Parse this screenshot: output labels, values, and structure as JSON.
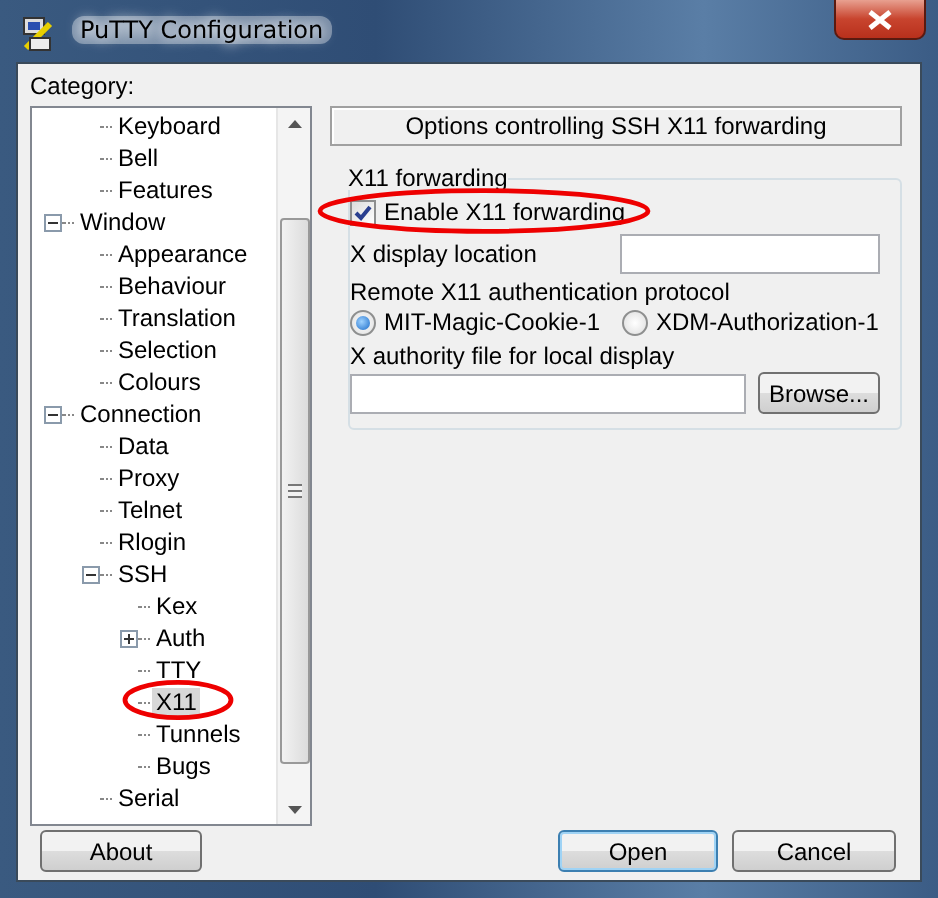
{
  "window": {
    "title": "PuTTY Configuration"
  },
  "category_label": "Category:",
  "tree": {
    "items": [
      {
        "children": [
          {
            "label": "Keyboard",
            "selected": false
          },
          {
            "label": "Bell",
            "selected": false
          },
          {
            "label": "Features",
            "selected": false
          }
        ]
      },
      {
        "label": "Window",
        "expanded": true,
        "selected": false,
        "children": [
          {
            "label": "Appearance",
            "selected": false
          },
          {
            "label": "Behaviour",
            "selected": false
          },
          {
            "label": "Translation",
            "selected": false
          },
          {
            "label": "Selection",
            "selected": false
          },
          {
            "label": "Colours",
            "selected": false
          }
        ]
      },
      {
        "label": "Connection",
        "expanded": true,
        "selected": false,
        "children": [
          {
            "label": "Data",
            "selected": false
          },
          {
            "label": "Proxy",
            "selected": false
          },
          {
            "label": "Telnet",
            "selected": false
          },
          {
            "label": "Rlogin",
            "selected": false
          },
          {
            "label": "SSH",
            "expanded": true,
            "selected": false,
            "children": [
              {
                "label": "Kex",
                "selected": false
              },
              {
                "label": "Auth",
                "expanded": false,
                "selected": false
              },
              {
                "label": "TTY",
                "selected": false
              },
              {
                "label": "X11",
                "selected": true
              },
              {
                "label": "Tunnels",
                "selected": false
              },
              {
                "label": "Bugs",
                "selected": false
              }
            ]
          },
          {
            "label": "Serial",
            "selected": false
          }
        ]
      }
    ]
  },
  "panel": {
    "header": "Options controlling SSH X11 forwarding",
    "group": {
      "title": "X11 forwarding",
      "enable": {
        "label": "Enable X11 forwarding",
        "checked": true
      },
      "display_location": {
        "label": "X display location"
      },
      "protocol": {
        "label": "Remote X11 authentication protocol",
        "options": [
          {
            "label": "MIT-Magic-Cookie-1",
            "selected": true
          },
          {
            "label": "XDM-Authorization-1",
            "selected": false
          }
        ]
      },
      "authority_file": {
        "label": "X authority file for local display",
        "button": "Browse..."
      }
    }
  },
  "buttons": {
    "about": "About",
    "open": "Open",
    "cancel": "Cancel"
  }
}
